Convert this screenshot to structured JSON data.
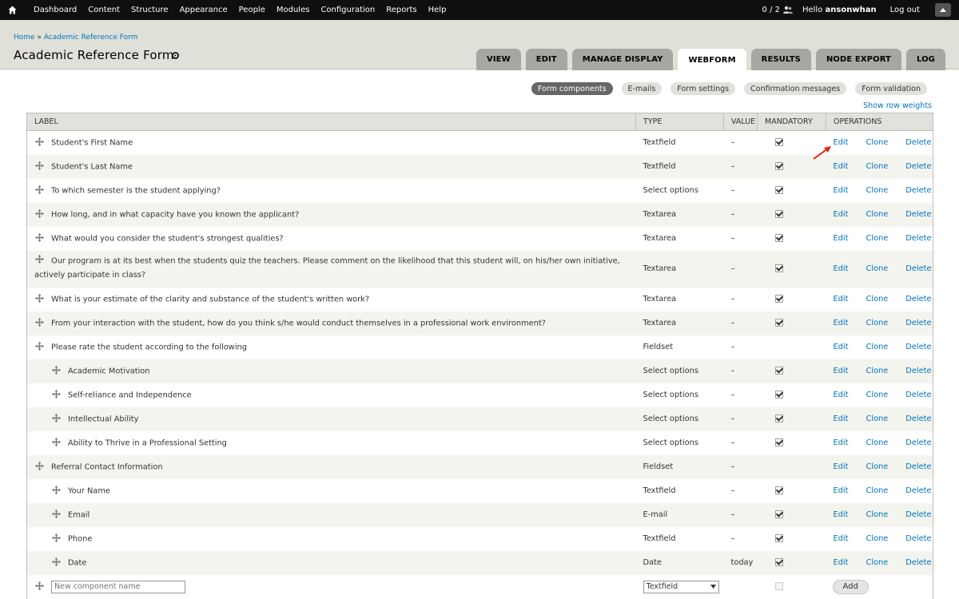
{
  "toolbar": {
    "items": [
      "Dashboard",
      "Content",
      "Structure",
      "Appearance",
      "People",
      "Modules",
      "Configuration",
      "Reports",
      "Help"
    ],
    "counter": "0 / 2",
    "hello_prefix": "Hello",
    "username": "ansonwhan",
    "logout": "Log out"
  },
  "breadcrumb": {
    "home": "Home",
    "sep": " » ",
    "current": "Academic Reference Form"
  },
  "page_title": "Academic Reference Form",
  "tabs": [
    {
      "label": "VIEW",
      "active": false
    },
    {
      "label": "EDIT",
      "active": false
    },
    {
      "label": "MANAGE DISPLAY",
      "active": false
    },
    {
      "label": "WEBFORM",
      "active": true
    },
    {
      "label": "RESULTS",
      "active": false
    },
    {
      "label": "NODE EXPORT",
      "active": false
    },
    {
      "label": "LOG",
      "active": false
    }
  ],
  "subtabs": [
    {
      "label": "Form components",
      "active": true
    },
    {
      "label": "E-mails",
      "active": false
    },
    {
      "label": "Form settings",
      "active": false
    },
    {
      "label": "Confirmation messages",
      "active": false
    },
    {
      "label": "Form validation",
      "active": false
    }
  ],
  "show_row_weights": "Show row weights",
  "table": {
    "headers": {
      "label": "LABEL",
      "type": "TYPE",
      "value": "VALUE",
      "mandatory": "MANDATORY",
      "operations": "OPERATIONS"
    },
    "ops": {
      "edit": "Edit",
      "clone": "Clone",
      "delete": "Delete"
    },
    "rows": [
      {
        "label": "Student's First Name",
        "type": "Textfield",
        "value": "–",
        "mandatory": true,
        "indent": 0
      },
      {
        "label": "Student's Last Name",
        "type": "Textfield",
        "value": "–",
        "mandatory": true,
        "indent": 0
      },
      {
        "label": "To which semester is the student applying?",
        "type": "Select options",
        "value": "–",
        "mandatory": true,
        "indent": 0
      },
      {
        "label": "How long, and in what capacity have you known the applicant?",
        "type": "Textarea",
        "value": "–",
        "mandatory": true,
        "indent": 0
      },
      {
        "label": "What would you consider the student's strongest qualities?",
        "type": "Textarea",
        "value": "–",
        "mandatory": true,
        "indent": 0
      },
      {
        "label": "Our program is at its best when the students quiz the teachers. Please comment on the likelihood that this student will, on his/her own initiative, actively participate in class?",
        "type": "Textarea",
        "value": "–",
        "mandatory": true,
        "indent": 0,
        "tall": true
      },
      {
        "label": "What is your estimate of the clarity and substance of the student's written work?",
        "type": "Textarea",
        "value": "–",
        "mandatory": true,
        "indent": 0
      },
      {
        "label": "From your interaction with the student, how do you think s/he would conduct themselves in a professional work environment?",
        "type": "Textarea",
        "value": "–",
        "mandatory": true,
        "indent": 0
      },
      {
        "label": "Please rate the student according to the following",
        "type": "Fieldset",
        "value": "–",
        "mandatory": null,
        "indent": 0
      },
      {
        "label": "Academic Motivation",
        "type": "Select options",
        "value": "–",
        "mandatory": true,
        "indent": 1
      },
      {
        "label": "Self-reliance and Independence",
        "type": "Select options",
        "value": "–",
        "mandatory": true,
        "indent": 1
      },
      {
        "label": "Intellectual Ability",
        "type": "Select options",
        "value": "–",
        "mandatory": true,
        "indent": 1
      },
      {
        "label": "Ability to Thrive in a Professional Setting",
        "type": "Select options",
        "value": "–",
        "mandatory": true,
        "indent": 1
      },
      {
        "label": "Referral Contact Information",
        "type": "Fieldset",
        "value": "–",
        "mandatory": null,
        "indent": 0
      },
      {
        "label": "Your Name",
        "type": "Textfield",
        "value": "–",
        "mandatory": true,
        "indent": 1
      },
      {
        "label": "Email",
        "type": "E-mail",
        "value": "–",
        "mandatory": true,
        "indent": 1
      },
      {
        "label": "Phone",
        "type": "Textfield",
        "value": "–",
        "mandatory": true,
        "indent": 1
      },
      {
        "label": "Date",
        "type": "Date",
        "value": "today",
        "mandatory": true,
        "indent": 1
      }
    ]
  },
  "new_component": {
    "placeholder": "New component name",
    "type_selected": "Textfield",
    "add_label": "Add"
  },
  "colors": {
    "toolbar": "#0f0f0f",
    "header": "#e0e0d8",
    "link": "#0074bd",
    "tab": "#a6a7a2",
    "annotation_arrow": "#e2231a"
  }
}
